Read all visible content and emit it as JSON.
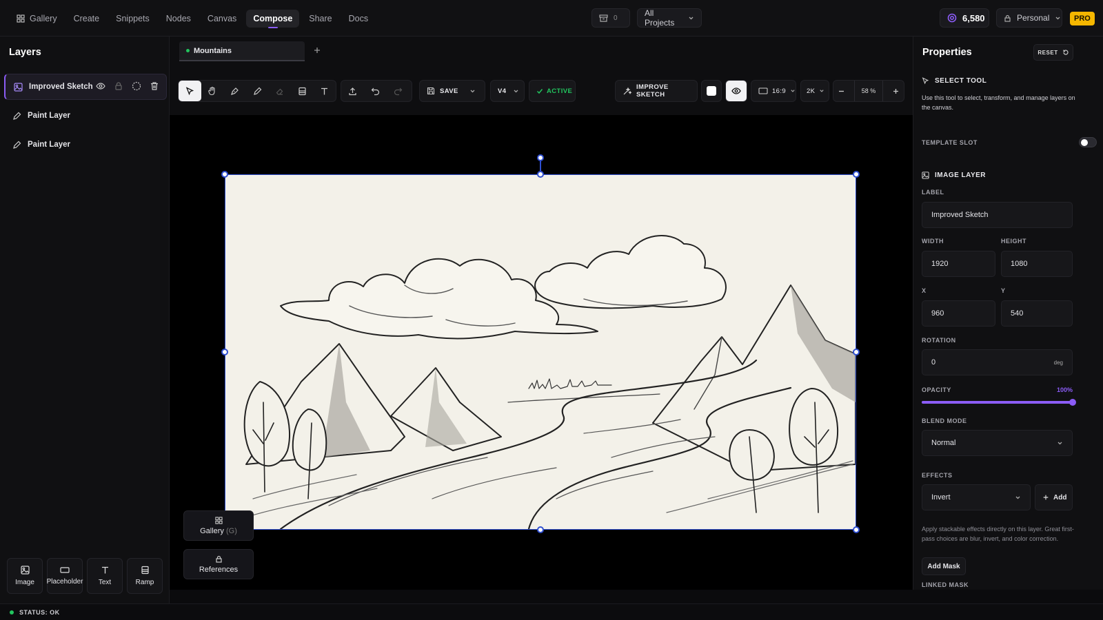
{
  "nav": {
    "items": [
      {
        "label": "Gallery",
        "icon": "grid-icon"
      },
      {
        "label": "Create"
      },
      {
        "label": "Snippets"
      },
      {
        "label": "Nodes"
      },
      {
        "label": "Canvas"
      },
      {
        "label": "Compose",
        "active": true
      },
      {
        "label": "Share"
      },
      {
        "label": "Docs"
      }
    ]
  },
  "header": {
    "queue_count": "0",
    "project_select": "All Projects",
    "credits": "6,580",
    "workspace": "Personal",
    "plan_badge": "PRO"
  },
  "layers_panel": {
    "title": "Layers",
    "items": [
      {
        "label": "Improved Sketch",
        "icon": "image-icon",
        "selected": true
      },
      {
        "label": "Paint Layer",
        "icon": "pencil-icon"
      },
      {
        "label": "Paint Layer",
        "icon": "pencil-icon"
      }
    ],
    "add_tools": [
      "Image",
      "Placeholder",
      "Text",
      "Ramp"
    ]
  },
  "tabs": [
    {
      "label": "Mountains"
    }
  ],
  "toolbar": {
    "save_label": "SAVE",
    "version": "V4",
    "status_label": "ACTIVE",
    "improve_label": "IMPROVE SKETCH",
    "aspect": "16:9",
    "resolution": "2K",
    "zoom": "58 %"
  },
  "canvas_overlay": {
    "gallery_label": "Gallery",
    "gallery_shortcut": "(G)",
    "references_label": "References"
  },
  "properties": {
    "title": "Properties",
    "reset_label": "RESET",
    "select_tool_heading": "SELECT TOOL",
    "select_tool_desc": "Use this tool to select, transform, and manage layers on the canvas.",
    "template_slot_label": "TEMPLATE SLOT",
    "template_slot_on": false,
    "image_layer_heading": "IMAGE LAYER",
    "label_label": "LABEL",
    "label_value": "Improved Sketch",
    "width_label": "WIDTH",
    "width_value": "1920",
    "height_label": "HEIGHT",
    "height_value": "1080",
    "x_label": "X",
    "x_value": "960",
    "y_label": "Y",
    "y_value": "540",
    "rotation_label": "ROTATION",
    "rotation_value": "0",
    "rotation_unit": "deg",
    "opacity_label": "OPACITY",
    "opacity_value": "100%",
    "opacity_fraction": 1.0,
    "blend_label": "BLEND MODE",
    "blend_value": "Normal",
    "effects_label": "EFFECTS",
    "effect_value": "Invert",
    "add_label": "Add",
    "effects_desc": "Apply stackable effects directly on this layer. Great first-pass choices are blur, invert, and color correction.",
    "add_mask_label": "Add Mask",
    "linked_mask_label": "LINKED MASK"
  },
  "status": {
    "text": "STATUS: OK",
    "color": "#22c55e"
  },
  "colors": {
    "accent": "#8b5cf6",
    "selection": "#2f4fd1",
    "success": "#22c55e",
    "pro": "#f5b700"
  }
}
